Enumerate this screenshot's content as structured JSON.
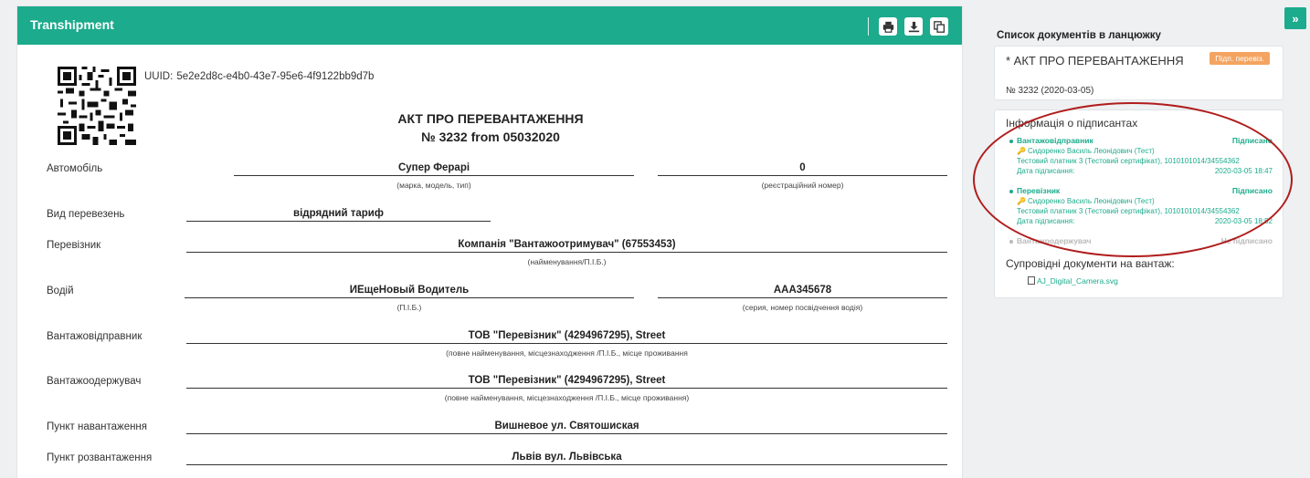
{
  "header": {
    "title": "Transhipment",
    "icons": [
      "print-icon",
      "download-icon",
      "copy-icon"
    ]
  },
  "uuid": {
    "label": "UUID:",
    "value": "5e2e2d8c-e4b0-43e7-95e6-4f9122bb9d7b"
  },
  "document": {
    "title": "АКТ ПРО ПЕРЕВАНТАЖЕННЯ",
    "subtitle": "№ 3232 from 05032020"
  },
  "fields": {
    "car_label": "Автомобіль",
    "car_value": "Супер Ферарі",
    "car_hint": "(марка, модель, тип)",
    "reg_value": "0",
    "reg_hint": "(реєстраційний номер)",
    "transport_label": "Вид перевезень",
    "transport_value": "відрядний тариф",
    "carrier_label": "Перевізник",
    "carrier_value": "Компанія \"Вантажоотримувач\" (67553453)",
    "carrier_hint": "(найменування/П.І.Б.)",
    "driver_label": "Водій",
    "driver_value": "ИЕщеНовый Водитель",
    "driver_hint": "(П.І.Б.)",
    "license_value": "ААА345678",
    "license_hint": "(серия, номер посвідчення водія)",
    "shipper_label": "Вантажовідправник",
    "shipper_value": "ТОВ \"Перевізник\" (4294967295), Street",
    "shipper_hint": "(повне найменування, місцезнаходження /П.І.Б., місце проживання",
    "consignee_label": "Вантажоодержувач",
    "consignee_value": "ТОВ \"Перевізник\" (4294967295), Street",
    "consignee_hint": "(повне найменування, місцезнаходження /П.І.Б., місце проживання)",
    "loading_label": "Пункт навантаження",
    "loading_value": "Вишневое ул. Святошиская",
    "unloading_label": "Пункт розвантаження",
    "unloading_value": "Львів вул. Львівська"
  },
  "sidebar": {
    "collapse_glyph": "»",
    "chain_title": "Список документів в ланцюжку",
    "chain_doc": {
      "title": "* АКТ ПРО ПЕРЕВАНТАЖЕННЯ",
      "badge": "Підп. перевіз.",
      "number": "№ 3232 (2020-03-05)"
    },
    "signers_title": "Інформація о підписантах",
    "signers": [
      {
        "role": "Вантажовідправник",
        "status": "Підписано",
        "name": "Сидоренко Василь Леонідович (Тест)",
        "cert": "Тестовий платник 3 (Тестовий сертифікат), 1010101014/34554362",
        "date_label": "Дата підписання:",
        "date": "2020-03-05 18:47"
      },
      {
        "role": "Перевізник",
        "status": "Підписано",
        "name": "Сидоренко Василь Леонідович (Тест)",
        "cert": "Тестовий платник 3 (Тестовий сертифікат), 1010101014/34554362",
        "date_label": "Дата підписання:",
        "date": "2020-03-05 18:52"
      },
      {
        "role": "Вантажоодержувач",
        "status": "Не підписано"
      }
    ],
    "attachments_title": "Супровідні документи на вантаж:",
    "attachment_file": "AJ_Digital_Camera.svg"
  },
  "colors": {
    "accent": "#1cab8c",
    "badge": "#f4a460",
    "annotation": "#b01c1c",
    "unsigned": "#b9b9b9"
  }
}
